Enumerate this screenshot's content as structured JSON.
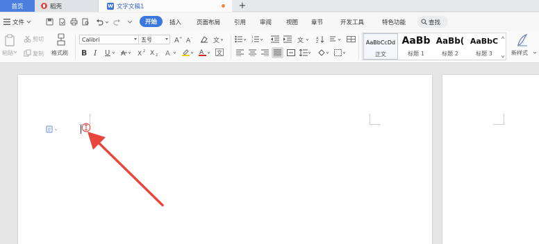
{
  "tabs": {
    "home": "首页",
    "daoke": "稻壳",
    "document": "文字文稿1",
    "add": "+"
  },
  "menu": {
    "file": "文件",
    "start": "开始",
    "insert": "插入",
    "layout": "页面布局",
    "reference": "引用",
    "review": "审阅",
    "view": "视图",
    "chapter": "章节",
    "devtools": "开发工具",
    "features": "特色功能",
    "search": "查找"
  },
  "ribbon": {
    "paste": "粘贴",
    "cut": "剪切",
    "copy": "复制",
    "format_painter": "格式刷",
    "font_name": "Calibri",
    "font_size": "五号",
    "new_style": "新样式"
  },
  "styles": [
    {
      "preview": "AaBbCcDd",
      "name": "正文"
    },
    {
      "preview": "AaBb",
      "name": "标题 1"
    },
    {
      "preview": "AaBb(",
      "name": "标题 2"
    },
    {
      "preview": "AaBbC",
      "name": "标题 3"
    }
  ],
  "colors": {
    "accent": "#3a78e0",
    "home_tab": "#4a7fe0",
    "arrow": "#e8453c",
    "unsaved": "#f08a3c"
  }
}
